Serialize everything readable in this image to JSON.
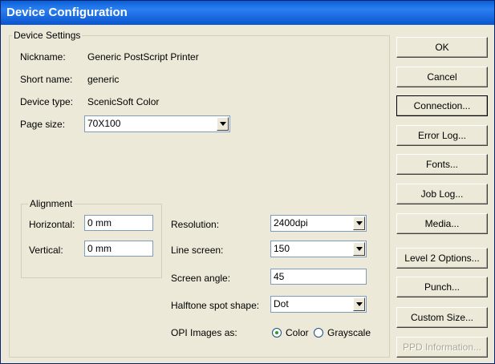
{
  "window": {
    "title": "Device Configuration"
  },
  "device_settings": {
    "group_label": "Device Settings",
    "nickname_label": "Nickname:",
    "nickname_value": "Generic PostScript Printer",
    "shortname_label": "Short name:",
    "shortname_value": "generic",
    "devicetype_label": "Device type:",
    "devicetype_value": "ScenicSoft Color",
    "pagesize_label": "Page size:",
    "pagesize_value": "70X100"
  },
  "alignment": {
    "group_label": "Alignment",
    "horizontal_label": "Horizontal:",
    "horizontal_value": "0 mm",
    "vertical_label": "Vertical:",
    "vertical_value": "0 mm"
  },
  "output": {
    "resolution_label": "Resolution:",
    "resolution_value": "2400dpi",
    "linescreen_label": "Line screen:",
    "linescreen_value": "150",
    "screenangle_label": "Screen angle:",
    "screenangle_value": "45",
    "halftone_label": "Halftone spot shape:",
    "halftone_value": "Dot",
    "opi_label": "OPI Images as:",
    "opi_color_label": "Color",
    "opi_grayscale_label": "Grayscale",
    "opi_selected": "Color"
  },
  "buttons": {
    "ok": "OK",
    "cancel": "Cancel",
    "connection": "Connection...",
    "error_log": "Error Log...",
    "fonts": "Fonts...",
    "job_log": "Job Log...",
    "media": "Media...",
    "level2": "Level 2 Options...",
    "punch": "Punch...",
    "custom_size": "Custom Size...",
    "ppd_info": "PPD Information..."
  }
}
